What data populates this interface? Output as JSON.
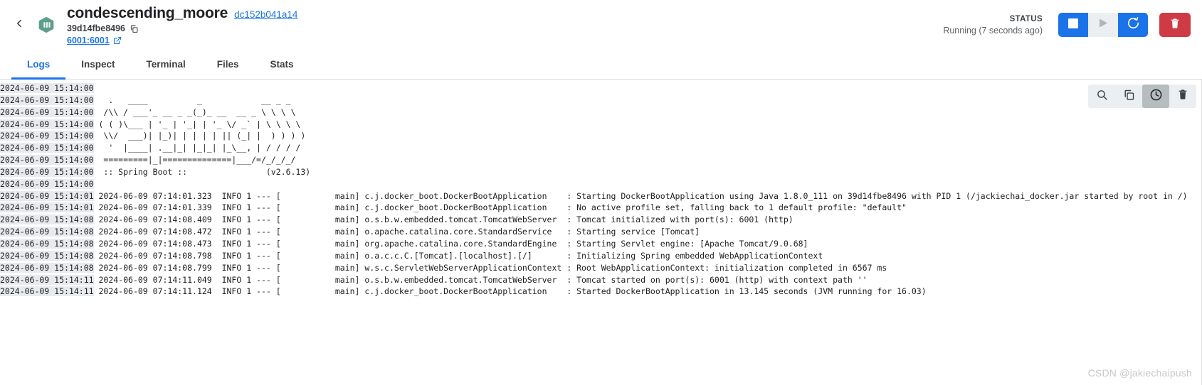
{
  "header": {
    "back_icon": "chevron-left-icon",
    "logo_icon": "docker-container-icon",
    "container_name": "condescending_moore",
    "image_tag": "dc152b041a14",
    "container_id": "39d14fbe8496",
    "copy_icon": "copy-icon",
    "port_mapping": "6001:6001",
    "external_link_icon": "external-link-icon",
    "status_label": "STATUS",
    "status_value": "Running (7 seconds ago)",
    "buttons": {
      "stop_icon": "stop-square-icon",
      "start_icon": "play-triangle-icon",
      "restart_icon": "restart-circular-arrow-icon",
      "delete_icon": "trash-icon"
    },
    "colors": {
      "accent_blue": "#1a73e8",
      "danger_red": "#cf3b44",
      "disabled_gray": "#eceff1",
      "logo_green": "#5d9e8a"
    }
  },
  "tabs": [
    {
      "label": "Logs",
      "active": true
    },
    {
      "label": "Inspect",
      "active": false
    },
    {
      "label": "Terminal",
      "active": false
    },
    {
      "label": "Files",
      "active": false
    },
    {
      "label": "Stats",
      "active": false
    }
  ],
  "log_toolbar": [
    {
      "icon": "search-icon",
      "active": false
    },
    {
      "icon": "copy-icon",
      "active": false
    },
    {
      "icon": "clock-icon",
      "active": true
    },
    {
      "icon": "trash-icon",
      "active": false
    }
  ],
  "log": {
    "lines": [
      {
        "ts": "2024-06-09 15:14:00",
        "msg": ""
      },
      {
        "ts": "2024-06-09 15:14:00",
        "msg": "  .   ____          _            __ _ _"
      },
      {
        "ts": "2024-06-09 15:14:00",
        "msg": " /\\\\ / ___'_ __ _ _(_)_ __  __ _ \\ \\ \\ \\"
      },
      {
        "ts": "2024-06-09 15:14:00",
        "msg": "( ( )\\___ | '_ | '_| | '_ \\/ _` | \\ \\ \\ \\"
      },
      {
        "ts": "2024-06-09 15:14:00",
        "msg": " \\\\/  ___)| |_)| | | | | || (_| |  ) ) ) )"
      },
      {
        "ts": "2024-06-09 15:14:00",
        "msg": "  '  |____| .__|_| |_|_| |_\\__, | / / / /"
      },
      {
        "ts": "2024-06-09 15:14:00",
        "msg": " =========|_|==============|___/=/_/_/_/"
      },
      {
        "ts": "2024-06-09 15:14:00",
        "msg": " :: Spring Boot ::                (v2.6.13)"
      },
      {
        "ts": "2024-06-09 15:14:00",
        "msg": ""
      },
      {
        "ts": "2024-06-09 15:14:01",
        "msg": "2024-06-09 07:14:01.323  INFO 1 --- [           main] c.j.docker_boot.DockerBootApplication    : Starting DockerBootApplication using Java 1.8.0_111 on 39d14fbe8496 with PID 1 (/jackiechai_docker.jar started by root in /)"
      },
      {
        "ts": "2024-06-09 15:14:01",
        "msg": "2024-06-09 07:14:01.339  INFO 1 --- [           main] c.j.docker_boot.DockerBootApplication    : No active profile set, falling back to 1 default profile: \"default\""
      },
      {
        "ts": "2024-06-09 15:14:08",
        "msg": "2024-06-09 07:14:08.409  INFO 1 --- [           main] o.s.b.w.embedded.tomcat.TomcatWebServer  : Tomcat initialized with port(s): 6001 (http)"
      },
      {
        "ts": "2024-06-09 15:14:08",
        "msg": "2024-06-09 07:14:08.472  INFO 1 --- [           main] o.apache.catalina.core.StandardService   : Starting service [Tomcat]"
      },
      {
        "ts": "2024-06-09 15:14:08",
        "msg": "2024-06-09 07:14:08.473  INFO 1 --- [           main] org.apache.catalina.core.StandardEngine  : Starting Servlet engine: [Apache Tomcat/9.0.68]"
      },
      {
        "ts": "2024-06-09 15:14:08",
        "msg": "2024-06-09 07:14:08.798  INFO 1 --- [           main] o.a.c.c.C.[Tomcat].[localhost].[/]       : Initializing Spring embedded WebApplicationContext"
      },
      {
        "ts": "2024-06-09 15:14:08",
        "msg": "2024-06-09 07:14:08.799  INFO 1 --- [           main] w.s.c.ServletWebServerApplicationContext : Root WebApplicationContext: initialization completed in 6567 ms"
      },
      {
        "ts": "2024-06-09 15:14:11",
        "msg": "2024-06-09 07:14:11.049  INFO 1 --- [           main] o.s.b.w.embedded.tomcat.TomcatWebServer  : Tomcat started on port(s): 6001 (http) with context path ''"
      },
      {
        "ts": "2024-06-09 15:14:11",
        "msg": "2024-06-09 07:14:11.124  INFO 1 --- [           main] c.j.docker_boot.DockerBootApplication    : Started DockerBootApplication in 13.145 seconds (JVM running for 16.03)"
      }
    ]
  },
  "watermark": "CSDN @jakiechaipush"
}
